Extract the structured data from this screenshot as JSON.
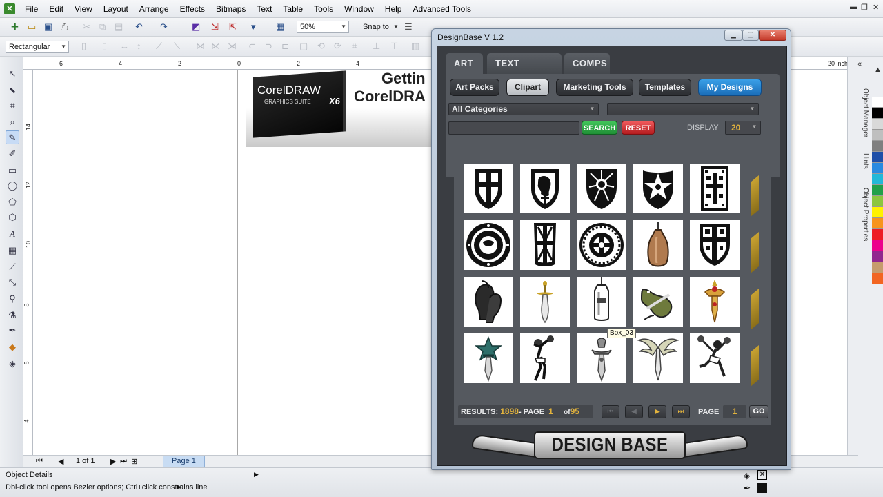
{
  "menubar": {
    "items": [
      "File",
      "Edit",
      "View",
      "Layout",
      "Arrange",
      "Effects",
      "Bitmaps",
      "Text",
      "Table",
      "Tools",
      "Window",
      "Help",
      "Advanced Tools"
    ]
  },
  "toolbar": {
    "zoom": "50%",
    "snap_to": "Snap to",
    "shape_mode": "Rectangular"
  },
  "ruler": {
    "units": "inches",
    "h_ticks": [
      "6",
      "4",
      "2",
      "0",
      "2",
      "4"
    ],
    "v_ticks": [
      "14",
      "12",
      "10",
      "8",
      "6",
      "4"
    ]
  },
  "canvas": {
    "banner_box_title": "CorelDRAW",
    "banner_box_sub": "GRAPHICS SUITE",
    "banner_box_version": "X6",
    "banner_line1": "Gettin",
    "banner_line2": "CorelDRA"
  },
  "page_nav": {
    "position": "1 of 1",
    "page_tab": "Page 1"
  },
  "dockers": {
    "tabs": [
      "Object Manager",
      "Hints",
      "Object Properties"
    ]
  },
  "status": {
    "line1": "Object Details",
    "line2": "Dbl-click tool opens Bezier options; Ctrl+click constrains line"
  },
  "palette": [
    "#ffffff",
    "#000000",
    "#d9d9d9",
    "#bfbfbf",
    "#7f7f7f",
    "#1f4fa8",
    "#2a8ae0",
    "#22b8d8",
    "#21a04a",
    "#8cc63f",
    "#fff200",
    "#f7941d",
    "#ed1c24",
    "#ec008c",
    "#92278f",
    "#c69c6d",
    "#f26522"
  ],
  "designbase": {
    "title": "DesignBase V 1.2",
    "tabs": [
      "ART",
      "TEXT EFFECTS",
      "COMPS"
    ],
    "subnav": [
      "Art Packs",
      "Clipart",
      "Marketing Tools",
      "Templates",
      "My Designs"
    ],
    "category": "All Categories",
    "search_label": "SEARCH",
    "reset_label": "RESET",
    "display_label": "DISPLAY",
    "display_value": "20",
    "tooltip": "Box_03",
    "results_label": "RESULTS:",
    "results_count": "1898",
    "page_label_inline": "- PAGE",
    "page_current": "1",
    "page_of": "of",
    "page_total": "95",
    "page_label": "PAGE",
    "page_input": "1",
    "go_label": "GO",
    "logo_text": "DESIGN BASE",
    "clipart_items": [
      "shield-cross",
      "shield-lion",
      "shield-sunburst",
      "shield-star",
      "banner-cross",
      "round-shield-emblem",
      "square-shield-cross",
      "round-ornament",
      "punching-bag",
      "shield-dark-cross",
      "boxing-gloves",
      "short-sword",
      "punching-bag-hanging",
      "dragon-sword",
      "ornate-dagger",
      "star-sword",
      "basketball-player",
      "knight-sword",
      "winged-sword",
      "cheerleader"
    ]
  }
}
